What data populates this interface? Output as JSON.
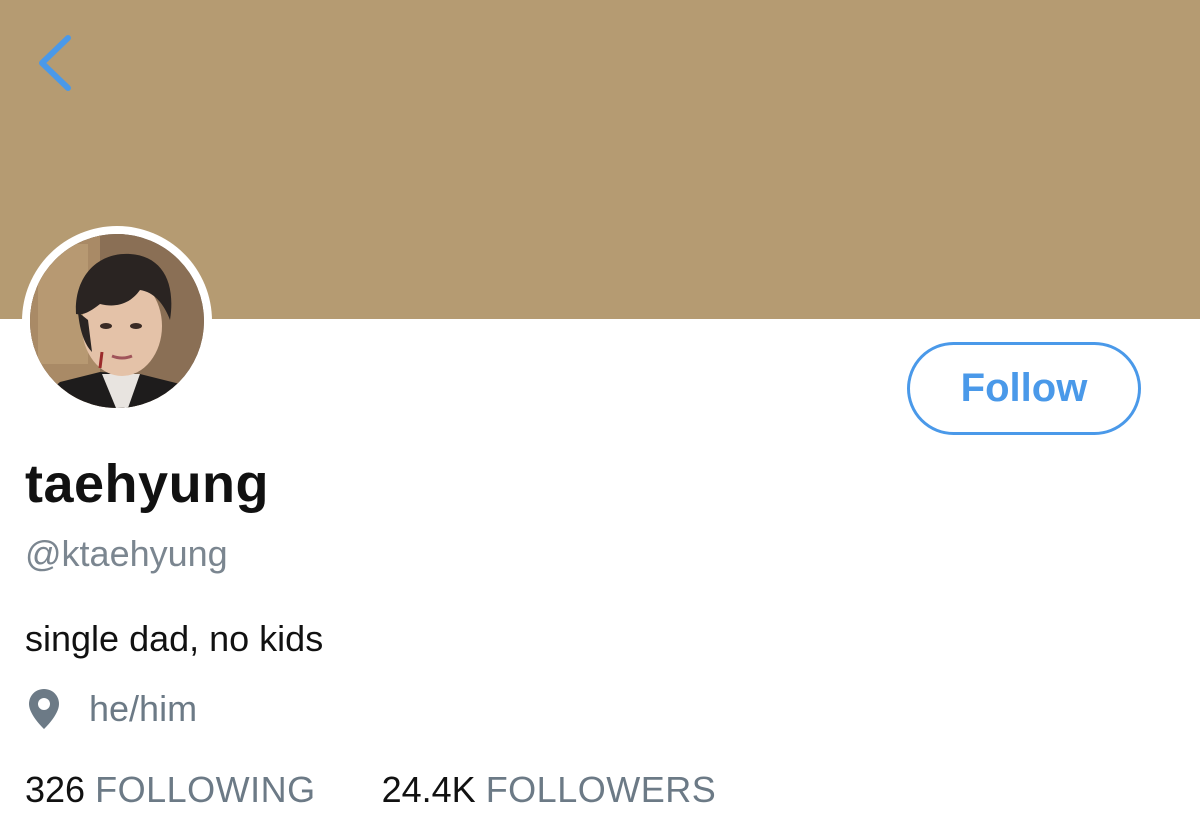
{
  "header": {
    "banner_color": "#b59b72",
    "back_icon": "chevron-left-icon"
  },
  "profile": {
    "display_name": "taehyung",
    "handle": "@ktaehyung",
    "bio": "single dad, no kids",
    "location_icon": "location-pin-icon",
    "location": "he/him",
    "follow_label": "Follow",
    "following_count": "326",
    "following_label": "FOLLOWING",
    "followers_count": "24.4K",
    "followers_label": "FOLLOWERS"
  },
  "colors": {
    "accent": "#4a99e9",
    "secondary_text": "#6c7a86",
    "primary_text": "#111111"
  }
}
